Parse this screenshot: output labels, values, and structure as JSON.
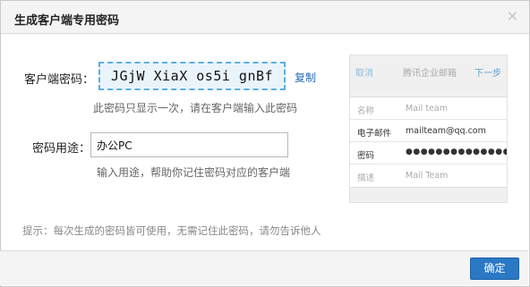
{
  "dialog": {
    "title": "生成客户端专用密码",
    "close_icon": "×"
  },
  "password": {
    "label": "客户端密码：",
    "value": "JGjW XiaX os5i gnBf",
    "copy_label": "复制",
    "hint": "此密码只显示一次，请在客户端输入此密码"
  },
  "usage": {
    "label": "密码用途：",
    "value": "办公PC",
    "hint": "输入用途，帮助你记住密码对应的客户端"
  },
  "tip": "提示：每次生成的密码皆可使用，无需记住此密码，请勿告诉他人",
  "preview": {
    "cancel": "取消",
    "title": "腾讯企业邮箱",
    "next": "下一步",
    "rows": [
      {
        "key": "名称",
        "value": "Mail team"
      },
      {
        "key": "电子邮件",
        "value": "mailteam@qq.com"
      },
      {
        "key": "密码",
        "value": "●●●●●●●●●●●●●●●●"
      },
      {
        "key": "描述",
        "value": "Mail Team"
      }
    ]
  },
  "footer": {
    "ok_label": "确定"
  },
  "colors": {
    "accent": "#2b78c5",
    "password_box_bg": "#e9f4fb",
    "password_box_border": "#5ab0e0",
    "link": "#2a6bb3"
  }
}
